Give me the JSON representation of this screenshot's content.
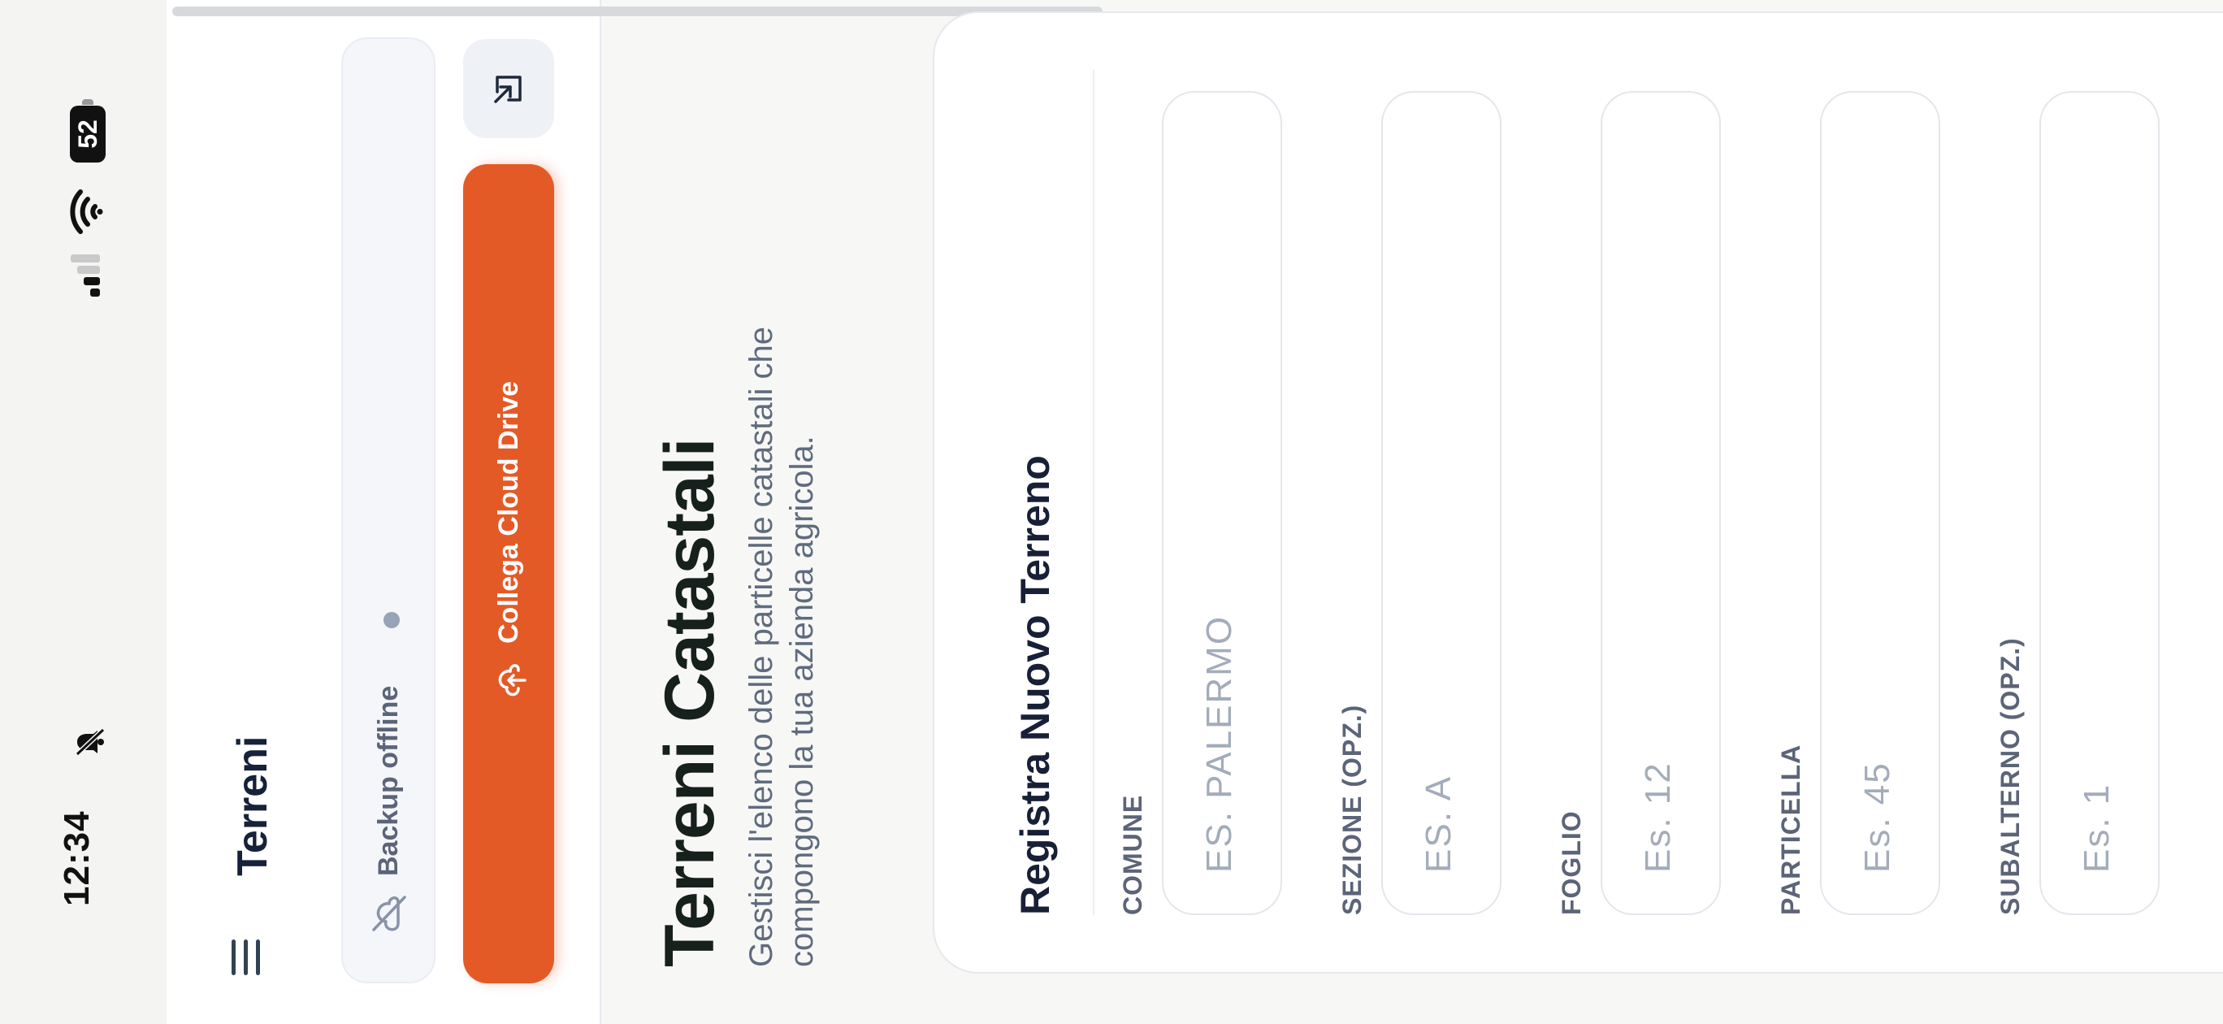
{
  "status_bar": {
    "time": "12:34",
    "battery": "52"
  },
  "header": {
    "title": "Terreni",
    "backup_status": "Backup offline",
    "cloud_button": "Collega Cloud Drive"
  },
  "page": {
    "title": "Terreni Catastali",
    "subtitle": "Gestisci l'elenco delle particelle catastali che compongono la tua azienda agricola."
  },
  "form": {
    "title": "Registra Nuovo Terreno",
    "fields": [
      {
        "label": "COMUNE",
        "placeholder": "ES. PALERMO"
      },
      {
        "label": "SEZIONE (OPZ.)",
        "placeholder": "ES. A"
      },
      {
        "label": "FOGLIO",
        "placeholder": "Es. 12"
      },
      {
        "label": "PARTICELLA",
        "placeholder": "Es. 45"
      },
      {
        "label": "SUBALTERNO (OPZ.)",
        "placeholder": "Es. 1"
      }
    ]
  },
  "colors": {
    "accent": "#e35a27",
    "text": "#16201c",
    "muted": "#5f6b7d"
  }
}
